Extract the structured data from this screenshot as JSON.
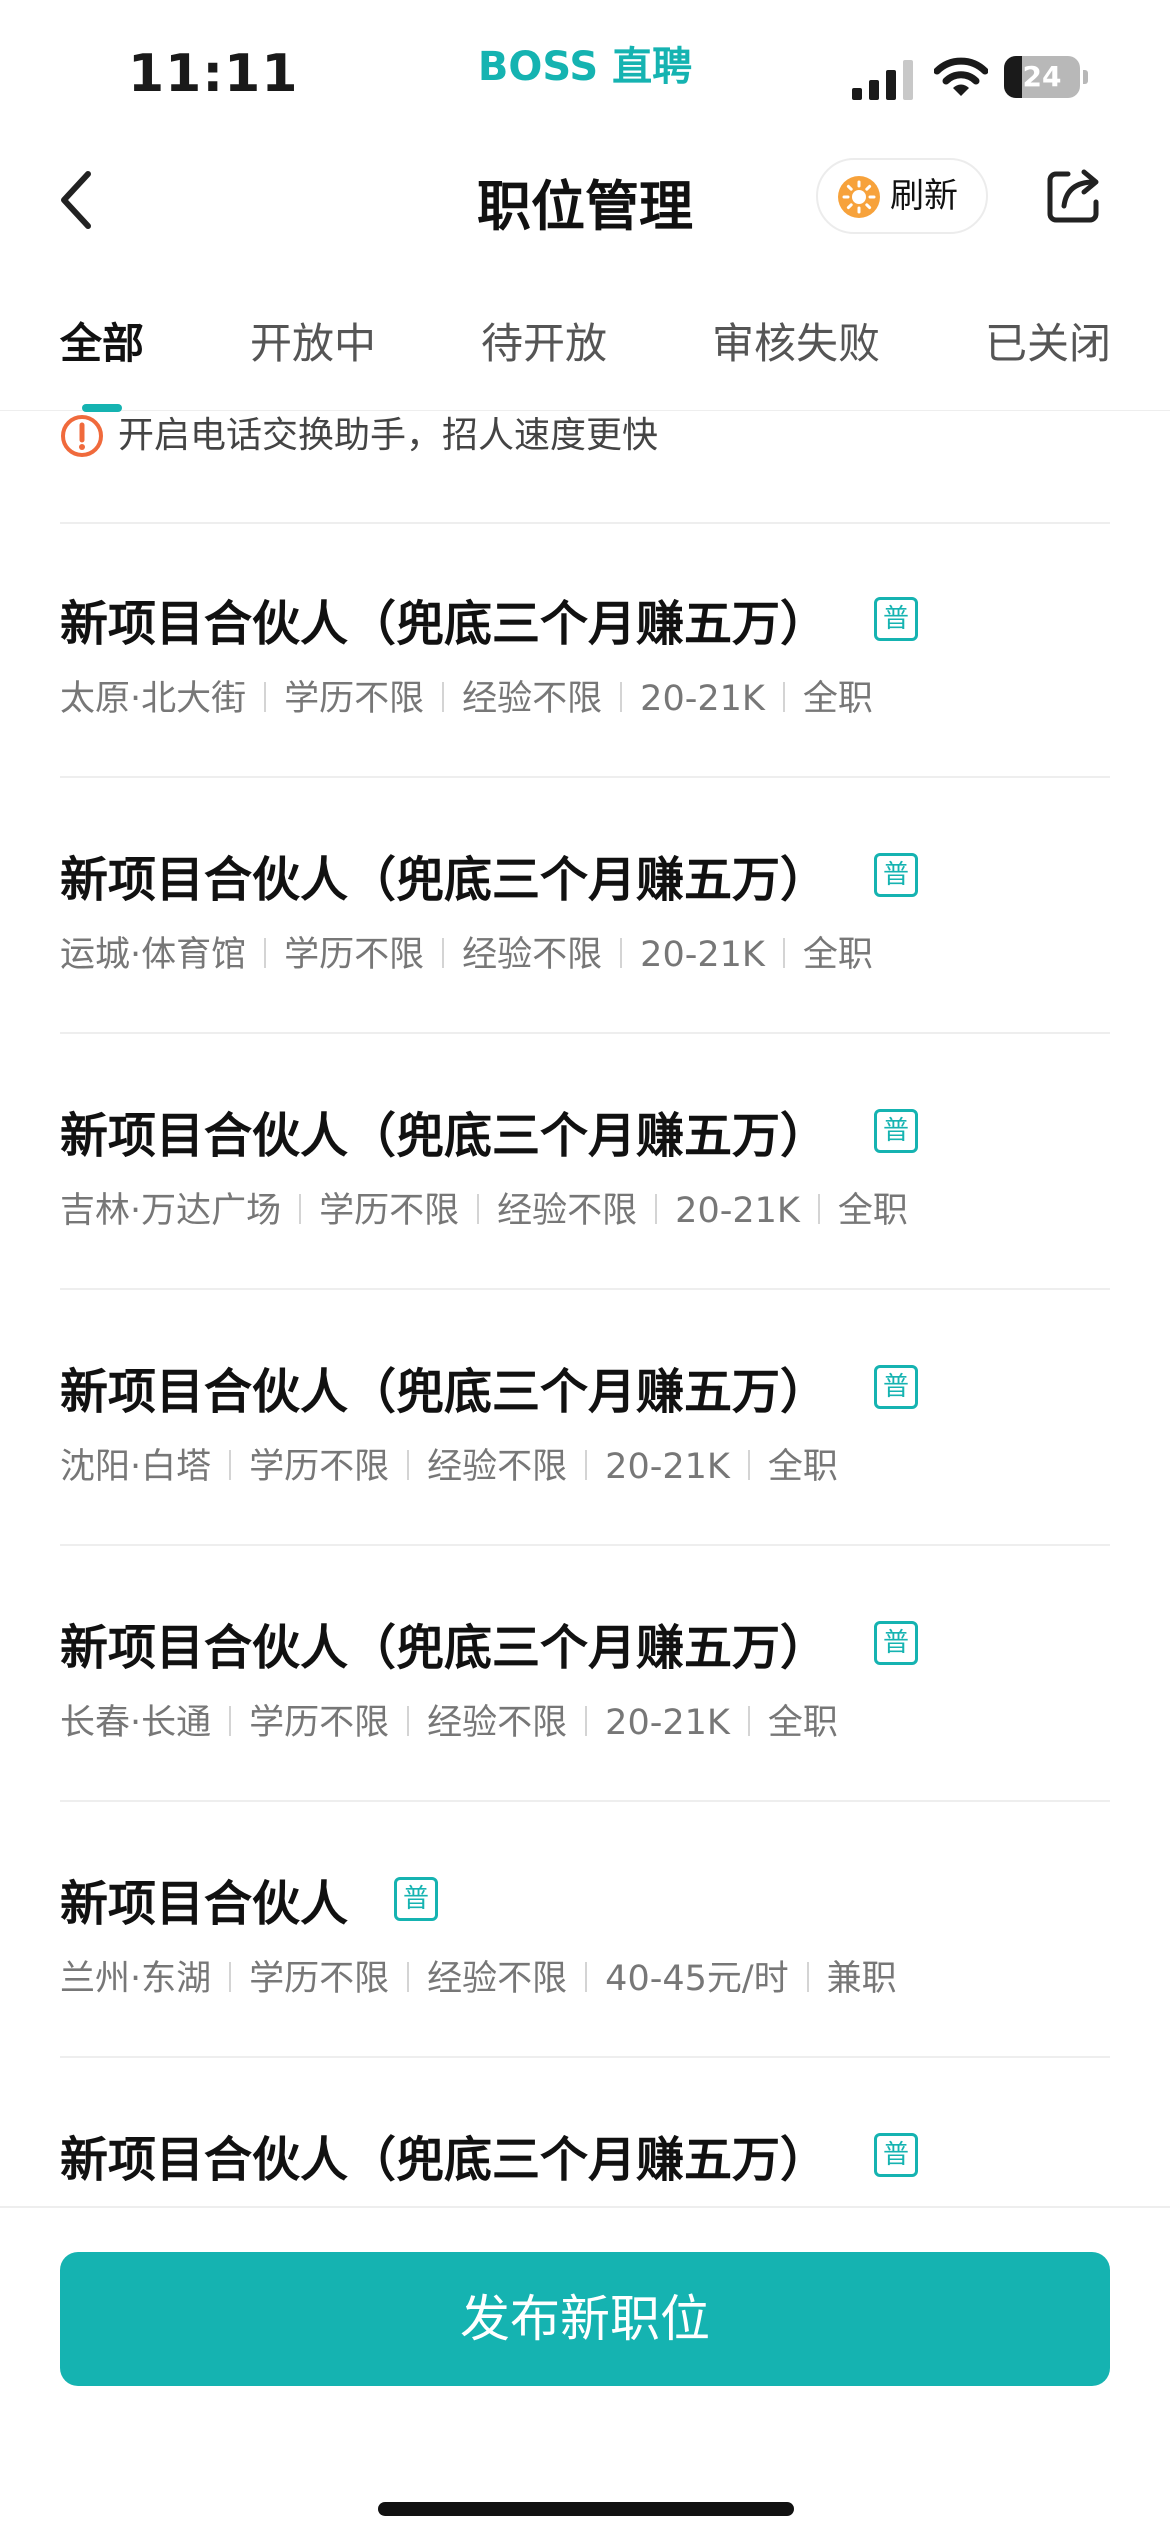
{
  "status_bar": {
    "time": "11:11",
    "brand": "BOSS 直聘",
    "battery": "24",
    "battery_level": 0.24
  },
  "nav": {
    "title": "职位管理",
    "refresh_label": "刷新"
  },
  "tabs": [
    {
      "label": "全部",
      "active": true
    },
    {
      "label": "开放中",
      "active": false
    },
    {
      "label": "待开放",
      "active": false
    },
    {
      "label": "审核失败",
      "active": false
    },
    {
      "label": "已关闭",
      "active": false
    }
  ],
  "notice": {
    "text": "开启电话交换助手，招人速度更快"
  },
  "jobs": [
    {
      "title": "新项目合伙人（兜底三个月赚五万）",
      "badge": "普",
      "meta": [
        "太原·北大街",
        "学历不限",
        "经验不限",
        "20-21K",
        "全职"
      ]
    },
    {
      "title": "新项目合伙人（兜底三个月赚五万）",
      "badge": "普",
      "meta": [
        "运城·体育馆",
        "学历不限",
        "经验不限",
        "20-21K",
        "全职"
      ]
    },
    {
      "title": "新项目合伙人（兜底三个月赚五万）",
      "badge": "普",
      "meta": [
        "吉林·万达广场",
        "学历不限",
        "经验不限",
        "20-21K",
        "全职"
      ]
    },
    {
      "title": "新项目合伙人（兜底三个月赚五万）",
      "badge": "普",
      "meta": [
        "沈阳·白塔",
        "学历不限",
        "经验不限",
        "20-21K",
        "全职"
      ]
    },
    {
      "title": "新项目合伙人（兜底三个月赚五万）",
      "badge": "普",
      "meta": [
        "长春·长通",
        "学历不限",
        "经验不限",
        "20-21K",
        "全职"
      ]
    },
    {
      "title": "新项目合伙人",
      "badge": "普",
      "meta": [
        "兰州·东湖",
        "学历不限",
        "经验不限",
        "40-45元/时",
        "兼职"
      ]
    },
    {
      "title": "新项目合伙人（兜底三个月赚五万）",
      "badge": "普",
      "meta": []
    }
  ],
  "bottom": {
    "publish_label": "发布新职位"
  },
  "colors": {
    "accent": "#15b3b1",
    "warning": "#f06a3c",
    "refresh_icon": "#f7a23b"
  }
}
